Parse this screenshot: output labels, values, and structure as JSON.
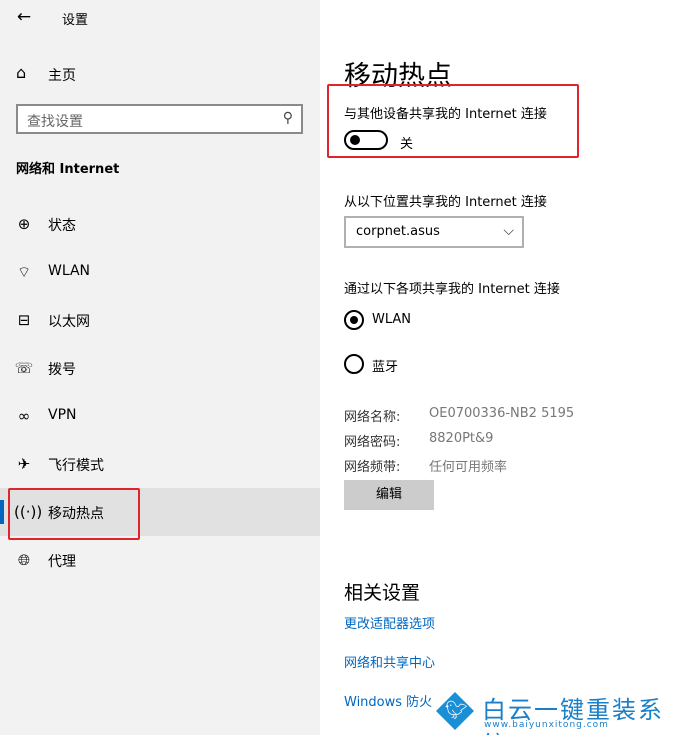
{
  "window": {
    "back_glyph": "←",
    "title": "设置"
  },
  "sidebar": {
    "home_label": "主页",
    "search_placeholder": "查找设置",
    "section_title": "网络和 Internet",
    "items": [
      {
        "label": "状态",
        "icon": "globe-status-icon"
      },
      {
        "label": "WLAN",
        "icon": "wifi-icon"
      },
      {
        "label": "以太网",
        "icon": "ethernet-icon"
      },
      {
        "label": "拨号",
        "icon": "dialup-icon"
      },
      {
        "label": "VPN",
        "icon": "vpn-icon"
      },
      {
        "label": "飞行模式",
        "icon": "airplane-icon"
      },
      {
        "label": "移动热点",
        "icon": "hotspot-icon",
        "active": true
      },
      {
        "label": "代理",
        "icon": "globe-icon"
      }
    ]
  },
  "main": {
    "title": "移动热点",
    "share_label": "与其他设备共享我的 Internet 连接",
    "toggle_state": "关",
    "source_label": "从以下位置共享我的 Internet 连接",
    "source_value": "corpnet.asus",
    "via_label": "通过以下各项共享我的 Internet 连接",
    "via_options": [
      {
        "label": "WLAN",
        "selected": true
      },
      {
        "label": "蓝牙",
        "selected": false
      }
    ],
    "network_name_key": "网络名称:",
    "network_name_value": "OE0700336-NB2 5195",
    "network_password_key": "网络密码:",
    "network_password_value": "8820Pt&9",
    "network_band_key": "网络频带:",
    "network_band_value": "任何可用频率",
    "edit_button": "编辑",
    "related_title": "相关设置",
    "links": [
      "更改适配器选项",
      "网络和共享中心",
      "Windows 防火墙"
    ]
  },
  "watermark": {
    "brand": "白云一键重装系统",
    "url": "www.baiyunxitong.com"
  },
  "colors": {
    "accent": "#0067c0",
    "highlight_box": "#e0242c",
    "sidebar_bg": "#f2f2f2"
  }
}
